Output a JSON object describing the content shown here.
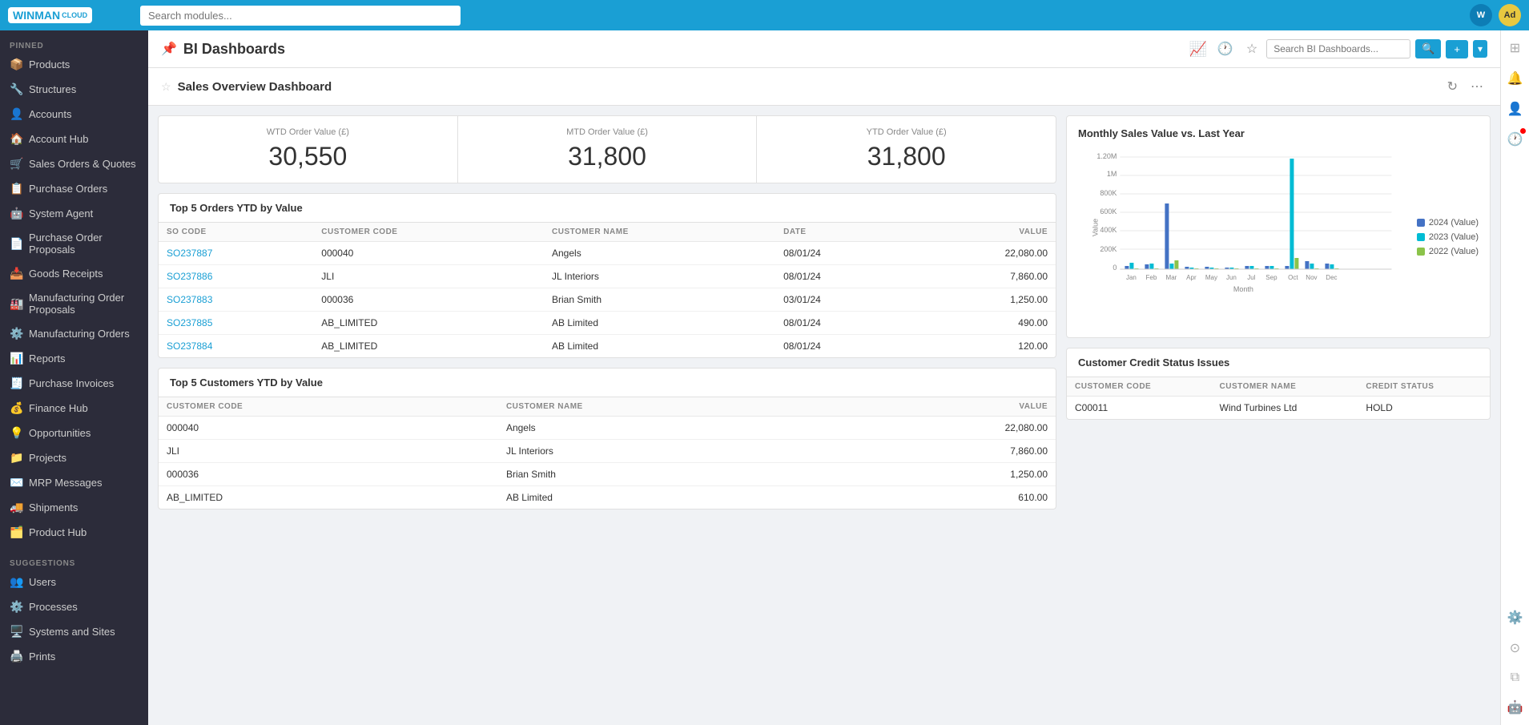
{
  "topbar": {
    "logo": "WINMAN",
    "logo_sub": "CLOUD",
    "search_placeholder": "Search modules...",
    "user_initials": "W",
    "user_initials2": "Ad"
  },
  "sidebar": {
    "pinned_label": "PINNED",
    "suggestions_label": "SUGGESTIONS",
    "pinned_items": [
      {
        "label": "Products",
        "icon": "📦"
      },
      {
        "label": "Structures",
        "icon": "🔧"
      },
      {
        "label": "Accounts",
        "icon": "👤"
      },
      {
        "label": "Account Hub",
        "icon": "🏠"
      },
      {
        "label": "Sales Orders & Quotes",
        "icon": "🛒"
      },
      {
        "label": "Purchase Orders",
        "icon": "📋"
      },
      {
        "label": "System Agent",
        "icon": "🤖"
      },
      {
        "label": "Purchase Order Proposals",
        "icon": "📄"
      },
      {
        "label": "Goods Receipts",
        "icon": "📥"
      },
      {
        "label": "Manufacturing Order Proposals",
        "icon": "🏭"
      },
      {
        "label": "Manufacturing Orders",
        "icon": "⚙️"
      },
      {
        "label": "Reports",
        "icon": "📊"
      },
      {
        "label": "Purchase Invoices",
        "icon": "🧾"
      },
      {
        "label": "Finance Hub",
        "icon": "💰"
      },
      {
        "label": "Opportunities",
        "icon": "💡"
      },
      {
        "label": "Projects",
        "icon": "📁"
      },
      {
        "label": "MRP Messages",
        "icon": "✉️"
      },
      {
        "label": "Shipments",
        "icon": "🚚"
      },
      {
        "label": "Product Hub",
        "icon": "🗂️"
      }
    ],
    "suggestion_items": [
      {
        "label": "Users",
        "icon": "👥"
      },
      {
        "label": "Processes",
        "icon": "⚙️"
      },
      {
        "label": "Systems and Sites",
        "icon": "🖥️"
      },
      {
        "label": "Prints",
        "icon": "🖨️"
      }
    ]
  },
  "page_header": {
    "icon": "📊",
    "title": "BI Dashboards",
    "search_placeholder": "Search BI Dashboards...",
    "add_label": "+",
    "history_icon": "🕐",
    "star_icon": "☆"
  },
  "sub_header": {
    "title": "Sales Overview Dashboard",
    "refresh_icon": "↻",
    "more_icon": "⋯"
  },
  "kpis": [
    {
      "label": "WTD Order Value (£)",
      "value": "30,550"
    },
    {
      "label": "MTD Order Value (£)",
      "value": "31,800"
    },
    {
      "label": "YTD Order Value (£)",
      "value": "31,800"
    }
  ],
  "top5_orders": {
    "title": "Top 5 Orders YTD by Value",
    "columns": [
      "SO CODE",
      "CUSTOMER CODE",
      "CUSTOMER NAME",
      "DATE",
      "VALUE"
    ],
    "rows": [
      [
        "SO237887",
        "000040",
        "Angels",
        "08/01/24",
        "22,080.00"
      ],
      [
        "SO237886",
        "JLI",
        "JL Interiors",
        "08/01/24",
        "7,860.00"
      ],
      [
        "SO237883",
        "000036",
        "Brian Smith",
        "03/01/24",
        "1,250.00"
      ],
      [
        "SO237885",
        "AB_LIMITED",
        "AB Limited",
        "08/01/24",
        "490.00"
      ],
      [
        "SO237884",
        "AB_LIMITED",
        "AB Limited",
        "08/01/24",
        "120.00"
      ]
    ]
  },
  "top5_customers": {
    "title": "Top 5 Customers YTD by Value",
    "columns": [
      "CUSTOMER CODE",
      "CUSTOMER NAME",
      "VALUE"
    ],
    "rows": [
      [
        "000040",
        "Angels",
        "22,080.00"
      ],
      [
        "JLI",
        "JL Interiors",
        "7,860.00"
      ],
      [
        "000036",
        "Brian Smith",
        "1,250.00"
      ],
      [
        "AB_LIMITED",
        "AB Limited",
        "610.00"
      ]
    ]
  },
  "chart": {
    "title": "Monthly Sales Value vs. Last Year",
    "y_labels": [
      "1.20M",
      "1M",
      "800K",
      "600K",
      "400K",
      "200K",
      "0"
    ],
    "x_labels": [
      "Jan",
      "Feb",
      "Mar",
      "Apr",
      "May",
      "Jun",
      "Jul",
      "Sep",
      "Oct",
      "Nov",
      "Dec"
    ],
    "legend": [
      {
        "label": "2024 (Value)",
        "color": "#4472c4"
      },
      {
        "label": "2023 (Value)",
        "color": "#00bcd4"
      },
      {
        "label": "2022 (Value)",
        "color": "#8bc34a"
      }
    ],
    "y_axis_label": "Value",
    "x_axis_label": "Month"
  },
  "credit_status": {
    "title": "Customer Credit Status Issues",
    "columns": [
      "CUSTOMER CODE",
      "CUSTOMER NAME",
      "CREDIT STATUS"
    ],
    "rows": [
      [
        "C00011",
        "Wind Turbines Ltd",
        "HOLD"
      ]
    ]
  }
}
